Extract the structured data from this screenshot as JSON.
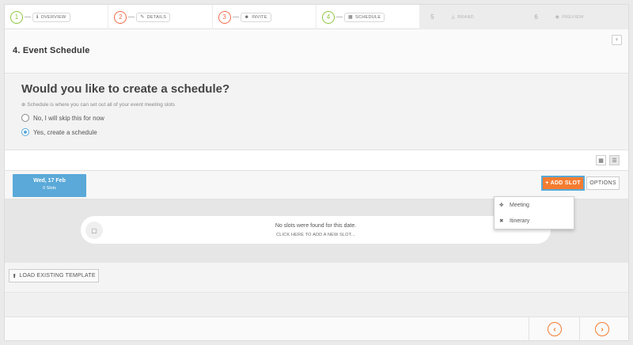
{
  "wizard": {
    "steps": [
      {
        "num": "1",
        "label": "OVERVIEW",
        "icon": "info-icon",
        "glyph": "ℹ"
      },
      {
        "num": "2",
        "label": "DETAILS",
        "icon": "tag-icon",
        "glyph": "✎"
      },
      {
        "num": "3",
        "label": "INVITE",
        "icon": "user-icon",
        "glyph": "☻"
      },
      {
        "num": "4",
        "label": "SCHEDULE",
        "icon": "calendar-icon",
        "glyph": "▦"
      },
      {
        "num": "5",
        "label": "BRAND",
        "icon": "brand-icon",
        "glyph": "◬"
      },
      {
        "num": "6",
        "label": "PREVIEW",
        "icon": "eye-icon",
        "glyph": "◉"
      }
    ]
  },
  "header": {
    "title": "4. Event Schedule",
    "bulb_glyph": "♀"
  },
  "question": {
    "heading": "Would you like to create a schedule?",
    "hint": "⊕ Schedule is where you can set out all of your event meeting slots",
    "option_no": "No, I will skip this for now",
    "option_yes": "Yes, create a schedule"
  },
  "viewbar": {
    "calendar_glyph": "▦",
    "list_glyph": "☰"
  },
  "datebar": {
    "date": "Wed, 17 Feb",
    "slots": "0 Slots",
    "add_slot": "+ ADD SLOT",
    "options": "OPTIONS"
  },
  "dropdown": {
    "items": [
      {
        "label": "Meeting",
        "glyph": "✤"
      },
      {
        "label": "Itinerary",
        "glyph": "✖"
      }
    ]
  },
  "empty": {
    "glyph": "▢",
    "line1": "No slots were found for this date.",
    "line2": "CLICK HERE TO ADD A NEW SLOT..."
  },
  "template": {
    "load_label": "LOAD EXISTING TEMPLATE",
    "glyph": "⬆"
  },
  "footer": {
    "prev_glyph": "‹",
    "next_glyph": "›"
  },
  "colors": {
    "accent_orange": "#f47c30",
    "accent_blue": "#5aa9d8",
    "step_green": "#8dc63f",
    "step_red": "#f26b4a"
  }
}
